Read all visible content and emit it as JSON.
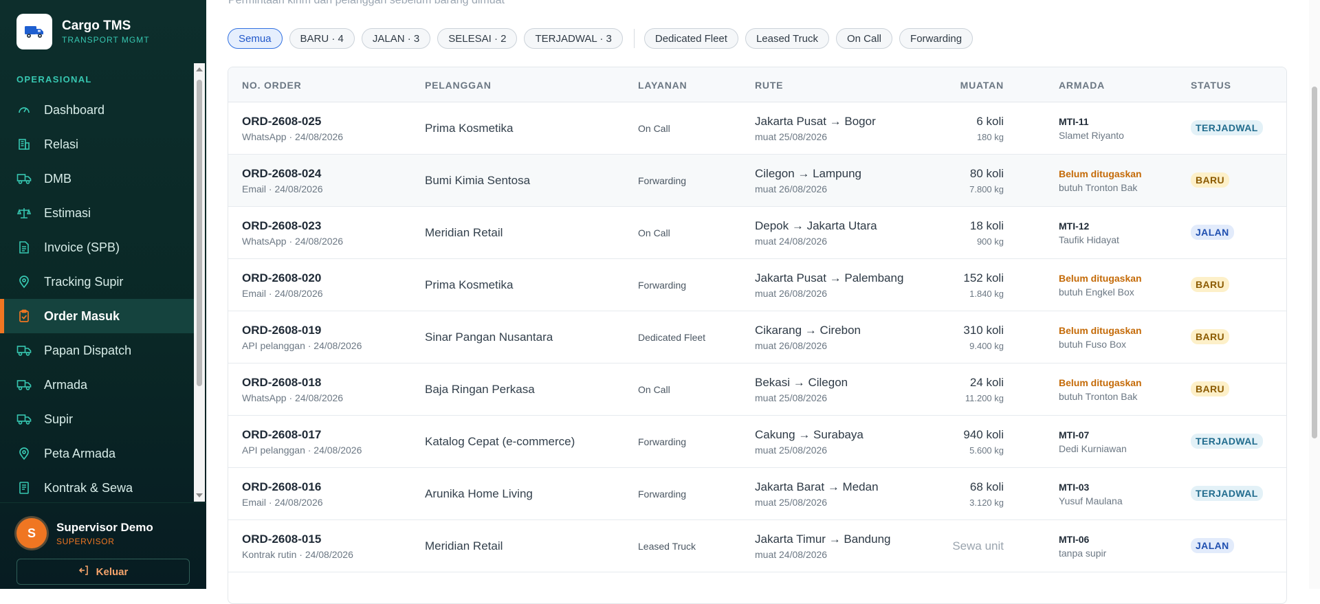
{
  "brand": {
    "title": "Cargo TMS",
    "subtitle": "TRANSPORT MGMT",
    "icon": "truck-icon"
  },
  "sidebar": {
    "section": "OPERASIONAL",
    "items": [
      {
        "label": "Dashboard",
        "icon": "gauge-icon"
      },
      {
        "label": "Relasi",
        "icon": "building-icon"
      },
      {
        "label": "DMB",
        "icon": "truck-icon"
      },
      {
        "label": "Estimasi",
        "icon": "scale-icon"
      },
      {
        "label": "Invoice (SPB)",
        "icon": "document-icon"
      },
      {
        "label": "Tracking Supir",
        "icon": "map-pin-icon"
      },
      {
        "label": "Order Masuk",
        "icon": "clipboard-check-icon",
        "active": true
      },
      {
        "label": "Papan Dispatch",
        "icon": "truck-icon"
      },
      {
        "label": "Armada",
        "icon": "truck-icon"
      },
      {
        "label": "Supir",
        "icon": "truck-icon"
      },
      {
        "label": "Peta Armada",
        "icon": "map-pin-icon"
      },
      {
        "label": "Kontrak & Sewa",
        "icon": "contract-icon"
      }
    ]
  },
  "user": {
    "initial": "S",
    "name": "Supervisor Demo",
    "role": "SUPERVISOR",
    "logout_label": "Keluar"
  },
  "main": {
    "subtitle": "Permintaan kirim dari pelanggan sebelum barang dimuat",
    "filters": {
      "status": [
        "Semua",
        "BARU · 4",
        "JALAN · 3",
        "SELESAI · 2",
        "TERJADWAL · 3"
      ],
      "service": [
        "Dedicated Fleet",
        "Leased Truck",
        "On Call",
        "Forwarding"
      ]
    },
    "table": {
      "headers": [
        "NO. ORDER",
        "PELANGGAN",
        "LAYANAN",
        "RUTE",
        "MUATAN",
        "ARMADA",
        "STATUS"
      ],
      "rows": [
        {
          "no": "ORD-2608-025",
          "src": "WhatsApp · 24/08/2026",
          "cust": "Prima Kosmetika",
          "svc": "On Call",
          "route": "Jakarta Pusat → Bogor",
          "load_date": "muat 25/08/2026",
          "koli": "6 koli",
          "kg": "180 kg",
          "fleet": "MTI-11",
          "driver": "Slamet Riyanto",
          "status": "TERJADWAL"
        },
        {
          "no": "ORD-2608-024",
          "src": "Email · 24/08/2026",
          "cust": "Bumi Kimia Sentosa",
          "svc": "Forwarding",
          "route": "Cilegon → Lampung",
          "load_date": "muat 26/08/2026",
          "koli": "80 koli",
          "kg": "7.800 kg",
          "fleet": "Belum ditugaskan",
          "driver": "butuh Tronton Bak",
          "status": "BARU"
        },
        {
          "no": "ORD-2608-023",
          "src": "WhatsApp · 24/08/2026",
          "cust": "Meridian Retail",
          "svc": "On Call",
          "route": "Depok → Jakarta Utara",
          "load_date": "muat 24/08/2026",
          "koli": "18 koli",
          "kg": "900 kg",
          "fleet": "MTI-12",
          "driver": "Taufik Hidayat",
          "status": "JALAN"
        },
        {
          "no": "ORD-2608-020",
          "src": "Email · 24/08/2026",
          "cust": "Prima Kosmetika",
          "svc": "Forwarding",
          "route": "Jakarta Pusat → Palembang",
          "load_date": "muat 26/08/2026",
          "koli": "152 koli",
          "kg": "1.840 kg",
          "fleet": "Belum ditugaskan",
          "driver": "butuh Engkel Box",
          "status": "BARU"
        },
        {
          "no": "ORD-2608-019",
          "src": "API pelanggan · 24/08/2026",
          "cust": "Sinar Pangan Nusantara",
          "svc": "Dedicated Fleet",
          "route": "Cikarang → Cirebon",
          "load_date": "muat 26/08/2026",
          "koli": "310 koli",
          "kg": "9.400 kg",
          "fleet": "Belum ditugaskan",
          "driver": "butuh Fuso Box",
          "status": "BARU"
        },
        {
          "no": "ORD-2608-018",
          "src": "WhatsApp · 24/08/2026",
          "cust": "Baja Ringan Perkasa",
          "svc": "On Call",
          "route": "Bekasi → Cilegon",
          "load_date": "muat 25/08/2026",
          "koli": "24 koli",
          "kg": "11.200 kg",
          "fleet": "Belum ditugaskan",
          "driver": "butuh Tronton Bak",
          "status": "BARU"
        },
        {
          "no": "ORD-2608-017",
          "src": "API pelanggan · 24/08/2026",
          "cust": "Katalog Cepat (e-commerce)",
          "svc": "Forwarding",
          "route": "Cakung → Surabaya",
          "load_date": "muat 25/08/2026",
          "koli": "940 koli",
          "kg": "5.600 kg",
          "fleet": "MTI-07",
          "driver": "Dedi Kurniawan",
          "status": "TERJADWAL"
        },
        {
          "no": "ORD-2608-016",
          "src": "Email · 24/08/2026",
          "cust": "Arunika Home Living",
          "svc": "Forwarding",
          "route": "Jakarta Barat → Medan",
          "load_date": "muat 25/08/2026",
          "koli": "68 koli",
          "kg": "3.120 kg",
          "fleet": "MTI-03",
          "driver": "Yusuf Maulana",
          "status": "TERJADWAL"
        },
        {
          "no": "ORD-2608-015",
          "src": "Kontrak rutin · 24/08/2026",
          "cust": "Meridian Retail",
          "svc": "Leased Truck",
          "route": "Jakarta Timur → Bandung",
          "load_date": "muat 24/08/2026",
          "koli": "Sewa unit",
          "kg": "",
          "fleet": "MTI-06",
          "driver": "tanpa supir",
          "status": "JALAN"
        }
      ]
    }
  },
  "colors": {
    "accent": "#f07622",
    "teal": "#37c7b1",
    "sidebar_bg": "#0d2e2c",
    "warn": "#c46a07"
  }
}
